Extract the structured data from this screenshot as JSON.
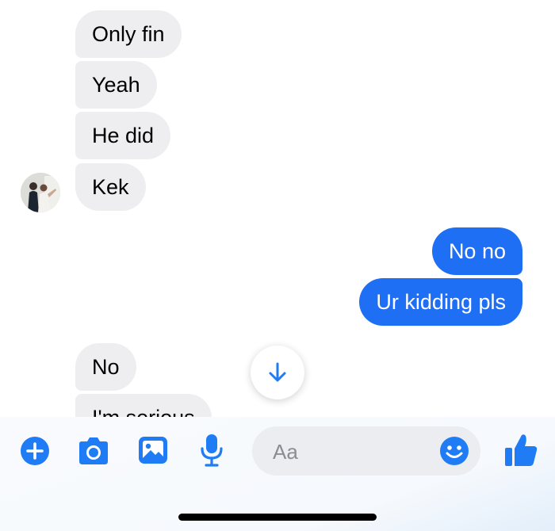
{
  "conversation": {
    "messages": [
      {
        "from": "contact",
        "text": "Only fin"
      },
      {
        "from": "contact",
        "text": "Yeah"
      },
      {
        "from": "contact",
        "text": "He did"
      },
      {
        "from": "contact",
        "text": "Kek"
      },
      {
        "from": "me",
        "text": "No no"
      },
      {
        "from": "me",
        "text": "Ur kidding pls"
      },
      {
        "from": "contact",
        "text": "No"
      },
      {
        "from": "contact",
        "text": "I'm serious"
      }
    ]
  },
  "composer": {
    "placeholder": "Aa"
  },
  "toolbar": {
    "icons": [
      "plus-icon",
      "camera-icon",
      "image-icon",
      "microphone-icon",
      "emoji-icon",
      "thumbs-up-icon"
    ]
  },
  "colors": {
    "sent_bubble": "#1f6ff4",
    "received_bubble": "#eeeef0",
    "accent": "#1f7cf4"
  }
}
